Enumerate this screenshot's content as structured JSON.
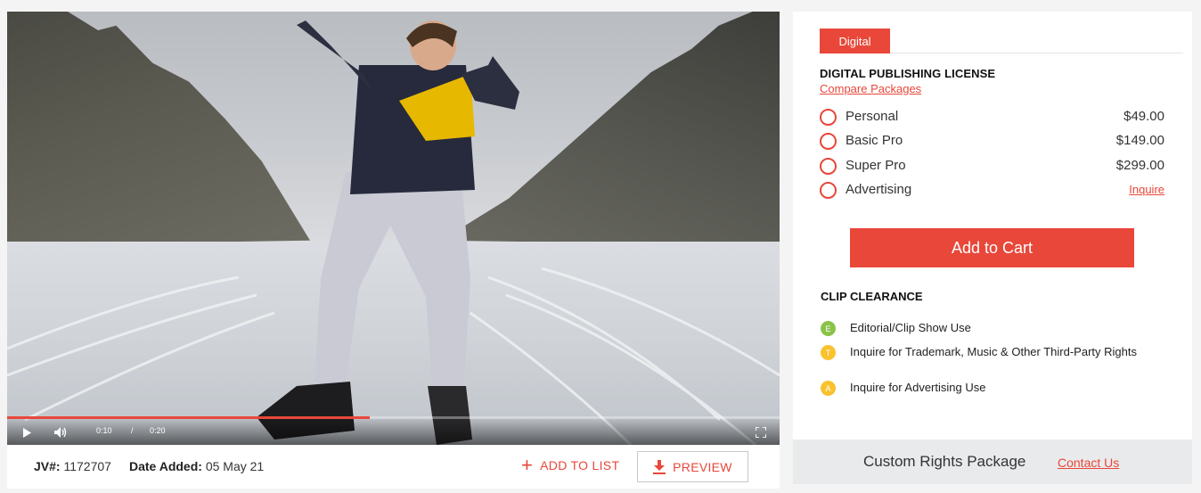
{
  "player": {
    "current_time": "0:10",
    "separator": "/",
    "duration": "0:20",
    "progress_fraction": 0.5,
    "icons": [
      "play-icon",
      "volume-icon",
      "fullscreen-icon"
    ]
  },
  "meta": {
    "jv_label": "JV#:",
    "jv_value": "1172707",
    "date_label": "Date Added:",
    "date_value": "05 May 21",
    "add_to_list": "ADD TO LIST",
    "preview": "PREVIEW"
  },
  "license": {
    "tab": "Digital",
    "title": "DIGITAL PUBLISHING LICENSE",
    "compare_link": "Compare Packages",
    "options": [
      {
        "label": "Personal",
        "price": "$49.00"
      },
      {
        "label": "Basic Pro",
        "price": "$149.00"
      },
      {
        "label": "Super Pro",
        "price": "$299.00"
      },
      {
        "label": "Advertising",
        "link": "Inquire"
      }
    ],
    "add_to_cart": "Add to Cart"
  },
  "clearance": {
    "title": "CLIP CLEARANCE",
    "items": [
      {
        "badge": "E",
        "color": "#8bc34a",
        "text": "Editorial/Clip Show Use"
      },
      {
        "badge": "T",
        "color": "#f9c22e",
        "text": "Inquire for Trademark, Music & Other Third-Party Rights"
      },
      {
        "badge": "A",
        "color": "#f9c22e",
        "text": "Inquire for Advertising Use"
      }
    ]
  },
  "custom": {
    "label": "Custom Rights Package",
    "contact": "Contact Us"
  },
  "colors": {
    "accent": "#e8473a"
  }
}
